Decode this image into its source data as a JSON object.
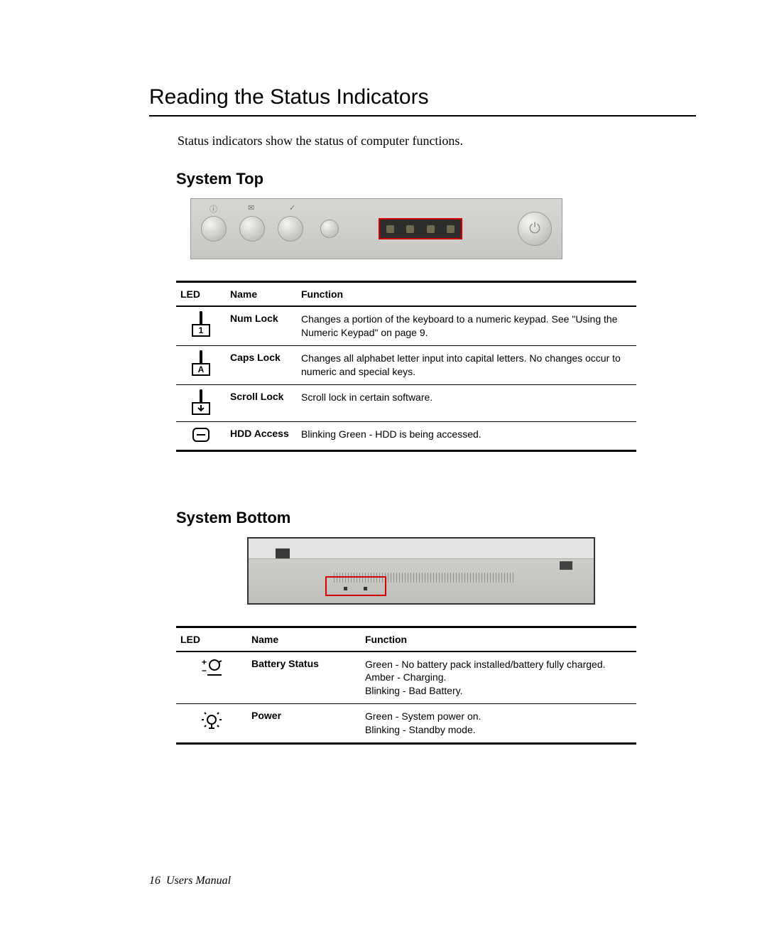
{
  "page_title": "Reading the Status Indicators",
  "intro": "Status indicators show the status of computer functions.",
  "section_top_heading": "System Top",
  "section_bottom_heading": "System Bottom",
  "table_top": {
    "headers": {
      "led": "LED",
      "name": "Name",
      "function": "Function"
    },
    "rows": [
      {
        "icon_symbol": "1",
        "name": "Num Lock",
        "function": "Changes a portion of the keyboard to a numeric keypad. See  \"Using the Numeric Keypad\" on page 9."
      },
      {
        "icon_symbol": "A",
        "name": "Caps Lock",
        "function": "Changes all alphabet letter input into capital letters. No changes occur to numeric and special keys."
      },
      {
        "icon_symbol": "↧",
        "name": "Scroll Lock",
        "function": "Scroll lock in certain software."
      },
      {
        "icon_symbol": "hdd",
        "name": "HDD Access",
        "function": "Blinking Green - HDD is being accessed."
      }
    ]
  },
  "table_bottom": {
    "headers": {
      "led": "LED",
      "name": "Name",
      "function": "Function"
    },
    "rows": [
      {
        "icon_name": "battery-icon",
        "name": "Battery Status",
        "function": "Green - No battery pack installed/battery fully charged.\nAmber - Charging.\nBlinking - Bad Battery."
      },
      {
        "icon_name": "power-light-icon",
        "name": "Power",
        "function": "Green - System power on.\nBlinking - Standby mode."
      }
    ]
  },
  "footer": {
    "page_number": "16",
    "label": "Users Manual"
  },
  "figure_top": {
    "buttons": [
      {
        "glyph": "ⓘ"
      },
      {
        "glyph": "✉"
      },
      {
        "glyph": "✓"
      }
    ],
    "led_count": 4,
    "power_glyph": "⏻"
  }
}
